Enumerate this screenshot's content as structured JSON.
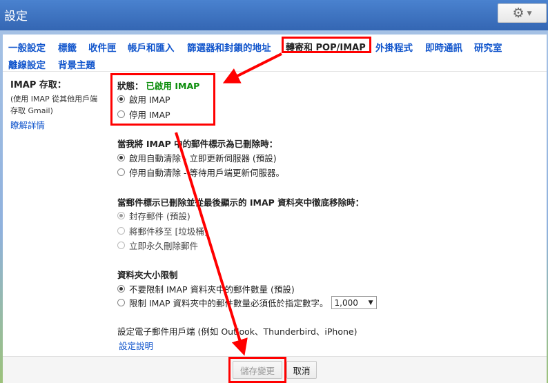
{
  "header": {
    "title": "設定"
  },
  "tabs": [
    {
      "label": "一般設定"
    },
    {
      "label": "標籤"
    },
    {
      "label": "收件匣"
    },
    {
      "label": "帳戶和匯入"
    },
    {
      "label": "篩選器和封鎖的地址"
    },
    {
      "label": "轉寄和 POP/IMAP",
      "active": true
    },
    {
      "label": "外掛程式"
    },
    {
      "label": "即時通訊"
    },
    {
      "label": "研究室"
    },
    {
      "label": "離線設定"
    },
    {
      "label": "背景主題"
    }
  ],
  "left": {
    "title": "IMAP 存取：",
    "note_line1": "(使用 IMAP 從其他用戶端",
    "note_line2": "存取 Gmail)",
    "link": "瞭解詳情"
  },
  "imap": {
    "status_label": "狀態：",
    "status_value": "已啟用 IMAP",
    "enable": "啟用 IMAP",
    "disable": "停用 IMAP"
  },
  "expunge": {
    "heading": "當我將 IMAP 中的郵件標示為已刪除時：",
    "auto_on": "啟用自動清除 - 立即更新伺服器 (預設)",
    "auto_off": "停用自動清除 - 等待用戶端更新伺服器。"
  },
  "deleted": {
    "heading": "當郵件標示已刪除並從最後顯示的 IMAP 資料夾中徹底移除時：",
    "archive": "封存郵件 (預設)",
    "trash": "將郵件移至 [垃圾桶]",
    "delete": "立即永久刪除郵件"
  },
  "folder_limit": {
    "heading": "資料夾大小限制",
    "no_limit": "不要限制 IMAP 資料夾中的郵件數量 (預設)",
    "limit": "限制 IMAP 資料夾中的郵件數量必須低於指定數字。",
    "selected_value": "1,000"
  },
  "client": {
    "heading": "設定電子郵件用戶端 (例如 Outlook、Thunderbird、iPhone)",
    "help_link": "設定說明"
  },
  "footer": {
    "save": "儲存變更",
    "cancel": "取消"
  },
  "colors": {
    "header": "#3b73c2",
    "link": "#1155cc",
    "enabled_green": "#0a8d0a",
    "annotation_red": "#ff0000"
  },
  "icons": {
    "settings": "gear-icon",
    "dropdown": "chevron-down-icon"
  }
}
